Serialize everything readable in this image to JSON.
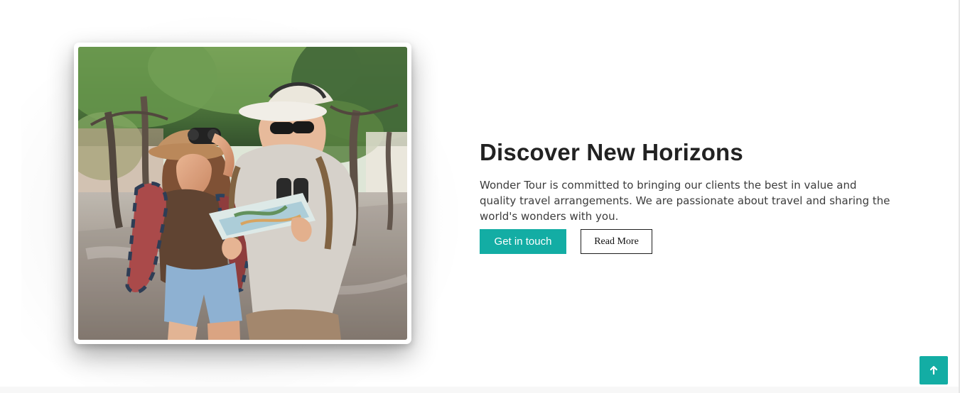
{
  "hero": {
    "photo": {
      "icon": "travel-couple-photo"
    },
    "headline": "Discover New Horizons",
    "description": "Wonder Tour is committed to bringing our clients the best in value and quality travel arrangements. We are passionate about travel and sharing the world's wonders with you.",
    "primary_button": "Get in touch",
    "secondary_button": "Read More"
  },
  "scroll_top": {
    "icon": "arrow-up-icon"
  },
  "colors": {
    "accent": "#13ada4",
    "headline": "#222222",
    "text": "#3c3c3c"
  }
}
